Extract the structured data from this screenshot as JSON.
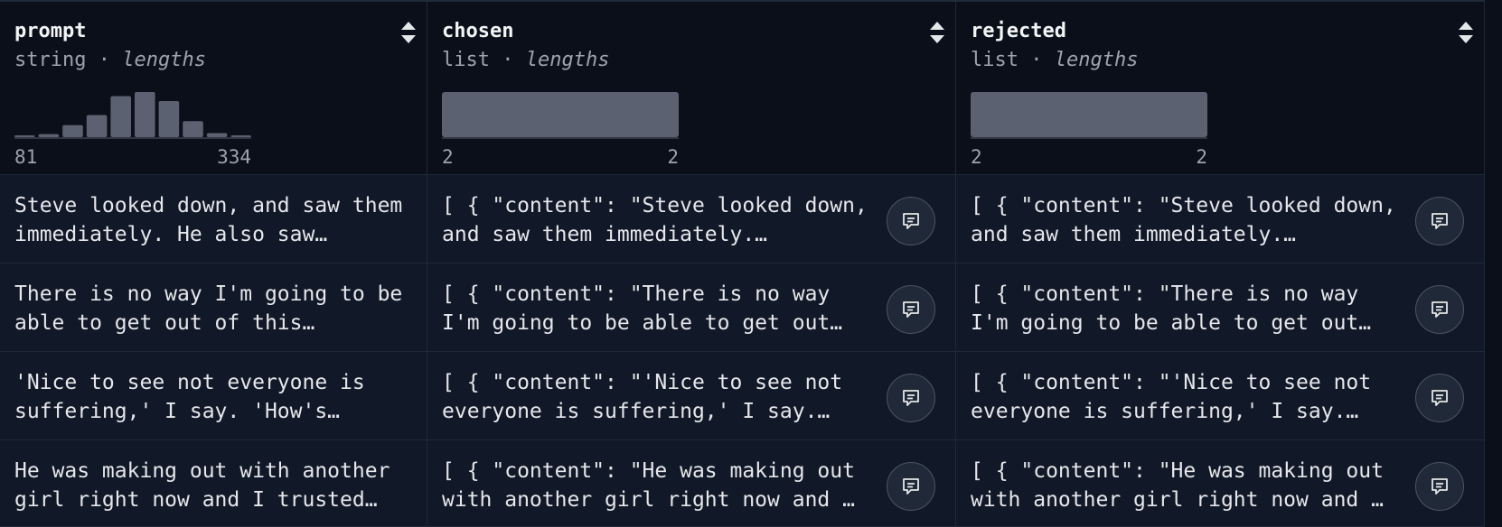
{
  "columns": [
    {
      "name": "prompt",
      "type": "string",
      "separator": "·",
      "stat": "lengths",
      "range_min": "81",
      "range_max": "334",
      "histogram": [
        2,
        6,
        24,
        44,
        82,
        90,
        72,
        32,
        8,
        3
      ]
    },
    {
      "name": "chosen",
      "type": "list",
      "separator": "·",
      "stat": "lengths",
      "range_min": "2",
      "range_max": "2",
      "histogram": [
        100
      ]
    },
    {
      "name": "rejected",
      "type": "list",
      "separator": "·",
      "stat": "lengths",
      "range_min": "2",
      "range_max": "2",
      "histogram": [
        100
      ]
    }
  ],
  "rows": [
    {
      "prompt": "Steve looked down, and saw them immediately. He also saw…",
      "chosen": "[ { \"content\": \"Steve looked down, and saw them immediately.…",
      "rejected": "[ { \"content\": \"Steve looked down, and saw them immediately.…"
    },
    {
      "prompt": "There is no way I'm going to be able to get out of this…",
      "chosen": "[ { \"content\": \"There is no way I'm going to be able to get out…",
      "rejected": "[ { \"content\": \"There is no way I'm going to be able to get out…"
    },
    {
      "prompt": "'Nice to see not everyone is suffering,' I say. 'How's…",
      "chosen": "[ { \"content\": \"'Nice to see not everyone is suffering,' I say.…",
      "rejected": "[ { \"content\": \"'Nice to see not everyone is suffering,' I say.…"
    },
    {
      "prompt": "He was making out with another girl right now and I trusted…",
      "chosen": "[ { \"content\": \"He was making out with another girl right now and …",
      "rejected": "[ { \"content\": \"He was making out with another girl right now and …"
    }
  ],
  "icons": {
    "sort": "sort-icon",
    "chat": "chat-bubble-icon"
  },
  "colors": {
    "background": "#0b0f19",
    "cell_background": "#111827",
    "bar": "#5b6170",
    "border": "#1f2937"
  }
}
